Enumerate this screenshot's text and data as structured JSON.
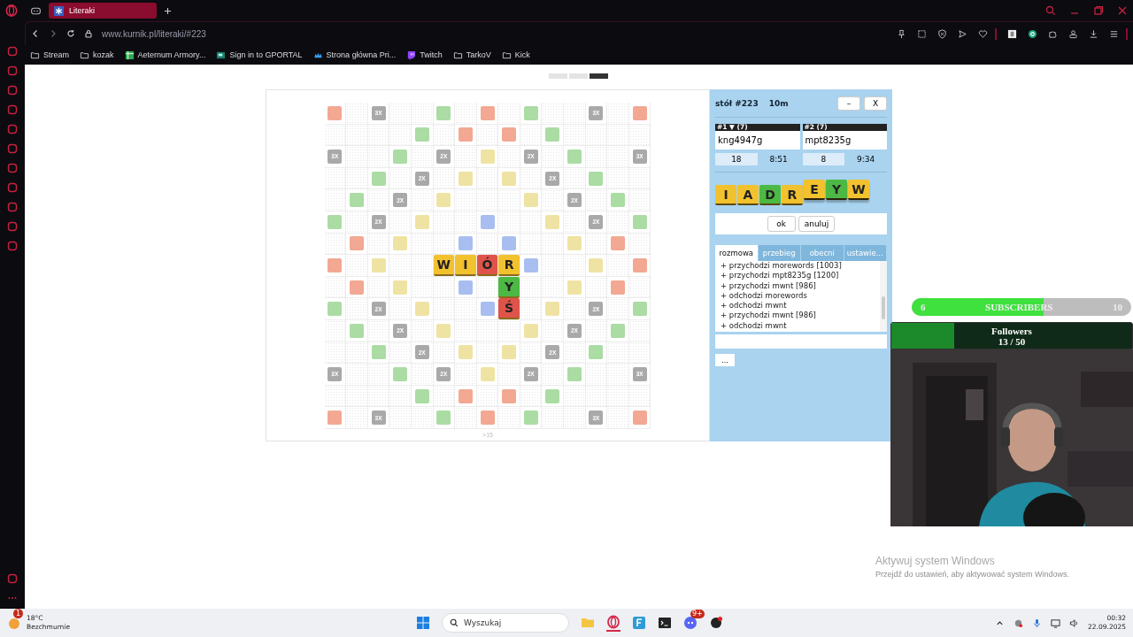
{
  "browser": {
    "tab": {
      "title": "Literaki",
      "selected": true
    },
    "url": "www.kurnik.pl/literaki/#223",
    "bookmarks": [
      {
        "label": "Stream",
        "kind": "folder"
      },
      {
        "label": "kozak",
        "kind": "folder"
      },
      {
        "label": "Aeternum Armory...",
        "kind": "sheet"
      },
      {
        "label": "Sign in to GPORTAL",
        "kind": "screen"
      },
      {
        "label": "Strona główna Pri...",
        "kind": "crown"
      },
      {
        "label": "Twitch",
        "kind": "twitch"
      },
      {
        "label": "TarkoV",
        "kind": "folder"
      },
      {
        "label": "Kick",
        "kind": "folder"
      }
    ]
  },
  "game": {
    "board": {
      "rows": [
        [
          {
            "kind": "red"
          },
          {
            "kind": "plain"
          },
          {
            "kind": "mult",
            "label": "3X"
          },
          {
            "kind": "plain"
          },
          {
            "kind": "plain"
          },
          {
            "kind": "green"
          },
          {
            "kind": "plain"
          },
          {
            "kind": "red"
          },
          {
            "kind": "plain"
          },
          {
            "kind": "green"
          },
          {
            "kind": "plain"
          },
          {
            "kind": "plain"
          },
          {
            "kind": "mult",
            "label": "3X"
          },
          {
            "kind": "plain"
          },
          {
            "kind": "red"
          }
        ],
        [
          {
            "kind": "plain"
          },
          {
            "kind": "plain"
          },
          {
            "kind": "plain"
          },
          {
            "kind": "plain"
          },
          {
            "kind": "green"
          },
          {
            "kind": "plain"
          },
          {
            "kind": "red"
          },
          {
            "kind": "plain"
          },
          {
            "kind": "red"
          },
          {
            "kind": "plain"
          },
          {
            "kind": "green"
          },
          {
            "kind": "plain"
          },
          {
            "kind": "plain"
          },
          {
            "kind": "plain"
          },
          {
            "kind": "plain"
          }
        ],
        [
          {
            "kind": "mult",
            "label": "3X"
          },
          {
            "kind": "plain"
          },
          {
            "kind": "plain"
          },
          {
            "kind": "green"
          },
          {
            "kind": "plain"
          },
          {
            "kind": "mult",
            "label": "2X"
          },
          {
            "kind": "plain"
          },
          {
            "kind": "yellow"
          },
          {
            "kind": "plain"
          },
          {
            "kind": "mult",
            "label": "2X"
          },
          {
            "kind": "plain"
          },
          {
            "kind": "green"
          },
          {
            "kind": "plain"
          },
          {
            "kind": "plain"
          },
          {
            "kind": "mult",
            "label": "3X"
          }
        ],
        [
          {
            "kind": "plain"
          },
          {
            "kind": "plain"
          },
          {
            "kind": "green"
          },
          {
            "kind": "plain"
          },
          {
            "kind": "mult",
            "label": "2X"
          },
          {
            "kind": "plain"
          },
          {
            "kind": "yellow"
          },
          {
            "kind": "plain"
          },
          {
            "kind": "yellow"
          },
          {
            "kind": "plain"
          },
          {
            "kind": "mult",
            "label": "2X"
          },
          {
            "kind": "plain"
          },
          {
            "kind": "green"
          },
          {
            "kind": "plain"
          },
          {
            "kind": "plain"
          }
        ],
        [
          {
            "kind": "plain"
          },
          {
            "kind": "green"
          },
          {
            "kind": "plain"
          },
          {
            "kind": "mult",
            "label": "2X"
          },
          {
            "kind": "plain"
          },
          {
            "kind": "yellow"
          },
          {
            "kind": "plain"
          },
          {
            "kind": "plain"
          },
          {
            "kind": "plain"
          },
          {
            "kind": "yellow"
          },
          {
            "kind": "plain"
          },
          {
            "kind": "mult",
            "label": "2X"
          },
          {
            "kind": "plain"
          },
          {
            "kind": "green"
          },
          {
            "kind": "plain"
          }
        ],
        [
          {
            "kind": "green"
          },
          {
            "kind": "plain"
          },
          {
            "kind": "mult",
            "label": "2X"
          },
          {
            "kind": "plain"
          },
          {
            "kind": "yellow"
          },
          {
            "kind": "plain"
          },
          {
            "kind": "plain"
          },
          {
            "kind": "blue"
          },
          {
            "kind": "plain"
          },
          {
            "kind": "plain"
          },
          {
            "kind": "yellow"
          },
          {
            "kind": "plain"
          },
          {
            "kind": "mult",
            "label": "2X"
          },
          {
            "kind": "plain"
          },
          {
            "kind": "green"
          }
        ],
        [
          {
            "kind": "plain"
          },
          {
            "kind": "red"
          },
          {
            "kind": "plain"
          },
          {
            "kind": "yellow"
          },
          {
            "kind": "plain"
          },
          {
            "kind": "plain"
          },
          {
            "kind": "blue"
          },
          {
            "kind": "plain"
          },
          {
            "kind": "blue"
          },
          {
            "kind": "plain"
          },
          {
            "kind": "plain"
          },
          {
            "kind": "yellow"
          },
          {
            "kind": "plain"
          },
          {
            "kind": "red"
          },
          {
            "kind": "plain"
          }
        ],
        [
          {
            "kind": "red"
          },
          {
            "kind": "plain"
          },
          {
            "kind": "yellow"
          },
          {
            "kind": "plain"
          },
          {
            "kind": "plain"
          },
          {
            "kind": "tile",
            "letter": "W",
            "color": "#f2c12e"
          },
          {
            "kind": "tile",
            "letter": "I",
            "color": "#f2c12e"
          },
          {
            "kind": "tile",
            "letter": "Ó",
            "color": "#e0534a"
          },
          {
            "kind": "tile",
            "letter": "R",
            "color": "#f2c12e"
          },
          {
            "kind": "blue"
          },
          {
            "kind": "plain"
          },
          {
            "kind": "plain"
          },
          {
            "kind": "yellow"
          },
          {
            "kind": "plain"
          },
          {
            "kind": "red"
          }
        ],
        [
          {
            "kind": "plain"
          },
          {
            "kind": "red"
          },
          {
            "kind": "plain"
          },
          {
            "kind": "yellow"
          },
          {
            "kind": "plain"
          },
          {
            "kind": "plain"
          },
          {
            "kind": "blue"
          },
          {
            "kind": "plain"
          },
          {
            "kind": "tile",
            "letter": "Y",
            "color": "#4cb944"
          },
          {
            "kind": "plain"
          },
          {
            "kind": "plain"
          },
          {
            "kind": "yellow"
          },
          {
            "kind": "plain"
          },
          {
            "kind": "red"
          },
          {
            "kind": "plain"
          }
        ],
        [
          {
            "kind": "green"
          },
          {
            "kind": "plain"
          },
          {
            "kind": "mult",
            "label": "2X"
          },
          {
            "kind": "plain"
          },
          {
            "kind": "yellow"
          },
          {
            "kind": "plain"
          },
          {
            "kind": "plain"
          },
          {
            "kind": "blue"
          },
          {
            "kind": "tile",
            "letter": "Ś",
            "color": "#e0534a"
          },
          {
            "kind": "plain"
          },
          {
            "kind": "yellow"
          },
          {
            "kind": "plain"
          },
          {
            "kind": "mult",
            "label": "2X"
          },
          {
            "kind": "plain"
          },
          {
            "kind": "green"
          }
        ],
        [
          {
            "kind": "plain"
          },
          {
            "kind": "green"
          },
          {
            "kind": "plain"
          },
          {
            "kind": "mult",
            "label": "2X"
          },
          {
            "kind": "plain"
          },
          {
            "kind": "yellow"
          },
          {
            "kind": "plain"
          },
          {
            "kind": "plain"
          },
          {
            "kind": "plain"
          },
          {
            "kind": "yellow"
          },
          {
            "kind": "plain"
          },
          {
            "kind": "mult",
            "label": "2X"
          },
          {
            "kind": "plain"
          },
          {
            "kind": "green"
          },
          {
            "kind": "plain"
          }
        ],
        [
          {
            "kind": "plain"
          },
          {
            "kind": "plain"
          },
          {
            "kind": "green"
          },
          {
            "kind": "plain"
          },
          {
            "kind": "mult",
            "label": "2X"
          },
          {
            "kind": "plain"
          },
          {
            "kind": "yellow"
          },
          {
            "kind": "plain"
          },
          {
            "kind": "yellow"
          },
          {
            "kind": "plain"
          },
          {
            "kind": "mult",
            "label": "2X"
          },
          {
            "kind": "plain"
          },
          {
            "kind": "green"
          },
          {
            "kind": "plain"
          },
          {
            "kind": "plain"
          }
        ],
        [
          {
            "kind": "mult",
            "label": "3X"
          },
          {
            "kind": "plain"
          },
          {
            "kind": "plain"
          },
          {
            "kind": "green"
          },
          {
            "kind": "plain"
          },
          {
            "kind": "mult",
            "label": "2X"
          },
          {
            "kind": "plain"
          },
          {
            "kind": "yellow"
          },
          {
            "kind": "plain"
          },
          {
            "kind": "mult",
            "label": "2X"
          },
          {
            "kind": "plain"
          },
          {
            "kind": "green"
          },
          {
            "kind": "plain"
          },
          {
            "kind": "plain"
          },
          {
            "kind": "mult",
            "label": "3X"
          }
        ],
        [
          {
            "kind": "plain"
          },
          {
            "kind": "plain"
          },
          {
            "kind": "plain"
          },
          {
            "kind": "plain"
          },
          {
            "kind": "green"
          },
          {
            "kind": "plain"
          },
          {
            "kind": "red"
          },
          {
            "kind": "plain"
          },
          {
            "kind": "red"
          },
          {
            "kind": "plain"
          },
          {
            "kind": "green"
          },
          {
            "kind": "plain"
          },
          {
            "kind": "plain"
          },
          {
            "kind": "plain"
          },
          {
            "kind": "plain"
          }
        ],
        [
          {
            "kind": "red"
          },
          {
            "kind": "plain"
          },
          {
            "kind": "mult",
            "label": "3X"
          },
          {
            "kind": "plain"
          },
          {
            "kind": "plain"
          },
          {
            "kind": "green"
          },
          {
            "kind": "plain"
          },
          {
            "kind": "red"
          },
          {
            "kind": "plain"
          },
          {
            "kind": "green"
          },
          {
            "kind": "plain"
          },
          {
            "kind": "plain"
          },
          {
            "kind": "mult",
            "label": "3X"
          },
          {
            "kind": "plain"
          },
          {
            "kind": "red"
          }
        ]
      ]
    },
    "board_footer": ">15",
    "panel": {
      "title": "stół #223",
      "time_control": "10m",
      "buttons": [
        "–",
        "X"
      ],
      "players": [
        {
          "header": "#1 ▼ (7)",
          "name": "kng4947g",
          "score": "18",
          "clock": "8:51"
        },
        {
          "header": "#2 (7)",
          "name": "mpt8235g",
          "score": "8",
          "clock": "9:34"
        }
      ],
      "rack": [
        {
          "letter": "I",
          "color": "#f2c12e",
          "raised": false
        },
        {
          "letter": "A",
          "color": "#f2c12e",
          "raised": false
        },
        {
          "letter": "D",
          "color": "#4cb944",
          "raised": false
        },
        {
          "letter": "R",
          "color": "#f2c12e",
          "raised": false
        },
        {
          "letter": "E",
          "color": "#f2c12e",
          "raised": true
        },
        {
          "letter": "Y",
          "color": "#4cb944",
          "raised": true
        },
        {
          "letter": "W",
          "color": "#f2c12e",
          "raised": true
        }
      ],
      "actions": [
        "ok",
        "anuluj"
      ],
      "tabs": [
        {
          "label": "rozmowa",
          "selected": true
        },
        {
          "label": "przebieg",
          "selected": false
        },
        {
          "label": "obecni",
          "selected": false
        },
        {
          "label": "ustawie...",
          "selected": false
        }
      ],
      "chat": [
        "+ przychodzi morewords [1003]",
        "+ przychodzi mpt8235g [1200]",
        "+ przychodzi mwnt [986]",
        "+ odchodzi morewords",
        "+ odchodzi mwnt",
        "+ przychodzi mwnt [986]",
        "+ odchodzi mwnt"
      ],
      "more": "..."
    }
  },
  "stream_overlay": {
    "subscribers": {
      "current": "6",
      "label": "SUBSCRIBERS",
      "goal": "10",
      "level": 0.6
    },
    "followers": {
      "label": "Followers",
      "count": "13 / 50",
      "level": 0.26
    }
  },
  "windows_notice": {
    "title": "Aktywuj system Windows",
    "text": "Przejdź do ustawień, aby aktywować system Windows."
  },
  "taskbar": {
    "weather": {
      "badge": "1",
      "temperature": "18°C",
      "condition": "Bezchmurnie"
    },
    "search": {
      "placeholder": "Wyszukaj"
    },
    "discord_badge": "9+",
    "time": "00:32",
    "date": "22.09.2025"
  }
}
